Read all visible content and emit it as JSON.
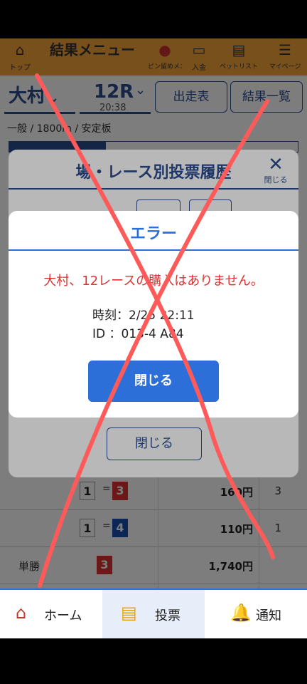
{
  "header": {
    "title": "結果メニュー",
    "items": [
      {
        "icon": "home-icon",
        "label": "トップ"
      },
      {
        "icon": "pin-icon",
        "label": "ピン留めメニュー"
      },
      {
        "icon": "deposit-icon",
        "label": "入金"
      },
      {
        "icon": "betlist-icon",
        "label": "ベットリスト"
      },
      {
        "icon": "menu-icon",
        "label": "マイページ"
      }
    ]
  },
  "selector": {
    "venue": "大村",
    "race": "12R",
    "race_time": "20:38",
    "entry_button": "出走表",
    "results_button": "結果一覧"
  },
  "race_info": "一般 / 1800m / 安定板",
  "table": {
    "rows": [
      {
        "label": "",
        "first": "1",
        "second": "3",
        "amount": "160円",
        "popularity": "3"
      },
      {
        "label": "",
        "first": "1",
        "second": "4",
        "amount": "110円",
        "popularity": "1"
      },
      {
        "label": "単勝",
        "first": "",
        "second": "3",
        "amount": "1,740円",
        "popularity": ""
      }
    ],
    "eq_symbol": "="
  },
  "history_dialog": {
    "title": "場・レース別投票履歴",
    "close_x_label": "閉じる",
    "close_button": "閉じる"
  },
  "error_dialog": {
    "title": "エラー",
    "message": "大村、12レースの購入はありません。",
    "time_line": "時刻：2/25 22:11",
    "id_line": "ID ：013-4 A84",
    "close_button": "閉じる"
  },
  "bottom_nav": [
    {
      "icon": "house-icon",
      "label": "ホーム"
    },
    {
      "icon": "ticket-icon",
      "label": "投票"
    },
    {
      "icon": "bell-icon",
      "label": "通知"
    }
  ],
  "colors": {
    "header_orange": "#f7a53b",
    "brand_navy": "#2c4d8f",
    "primary_blue": "#2c6fd8",
    "error_red": "#d33333",
    "annotation_red": "#ff5a5a"
  }
}
